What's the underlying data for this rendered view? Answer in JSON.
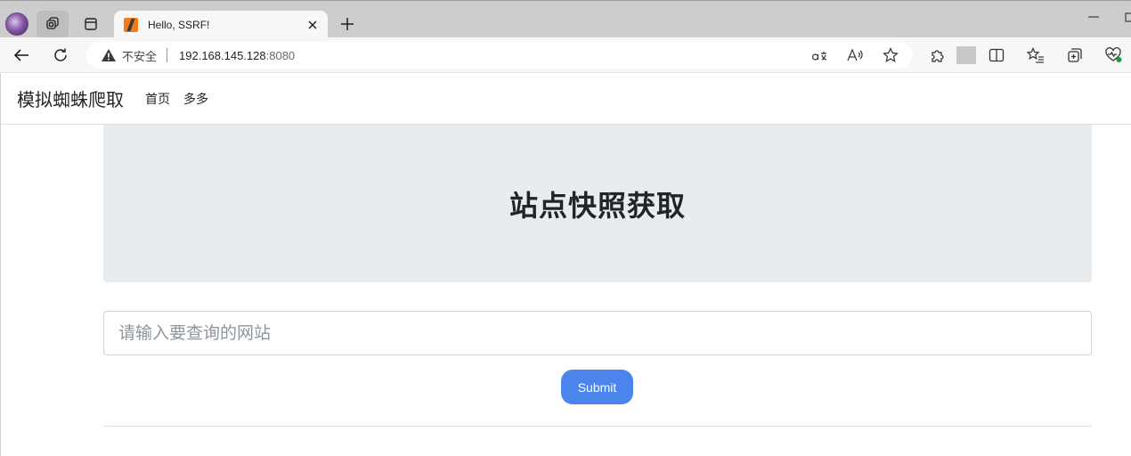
{
  "browser": {
    "tab": {
      "title": "Hello, SSRF!"
    },
    "address": {
      "security_label": "不安全",
      "host": "192.168.145.128",
      "port": ":8080"
    }
  },
  "site": {
    "brand": "模拟蜘蛛爬取",
    "nav": [
      {
        "label": "首页"
      },
      {
        "label": "多多"
      }
    ],
    "heading": "站点快照获取",
    "form": {
      "placeholder": "请输入要查询的网站",
      "submit_label": "Submit"
    }
  },
  "colors": {
    "accent": "#4a84ec",
    "jumbotron_bg": "#e9ecef"
  }
}
